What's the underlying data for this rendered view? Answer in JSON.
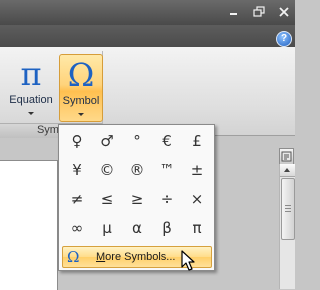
{
  "window": {
    "controls": [
      {
        "name": "minimize",
        "icon": "minimize-icon"
      },
      {
        "name": "restore",
        "icon": "restore-icon"
      },
      {
        "name": "close",
        "icon": "close-icon"
      }
    ],
    "help_glyph": "?"
  },
  "ribbon": {
    "group_label": "Symb",
    "equation": {
      "label": "Equation",
      "glyph": "π",
      "icon": "pi-icon"
    },
    "symbol": {
      "label": "Symbol",
      "glyph": "Ω",
      "icon": "omega-icon"
    }
  },
  "dropdown": {
    "symbols": [
      [
        "♀",
        "♂",
        "°",
        "€",
        "£"
      ],
      [
        "¥",
        "©",
        "®",
        "™",
        "±"
      ],
      [
        "≠",
        "≤",
        "≥",
        "÷",
        "×"
      ],
      [
        "∞",
        "μ",
        "α",
        "β",
        "π"
      ]
    ],
    "more_glyph": "Ω",
    "more_label_first": "M",
    "more_label_rest": "ore Symbols..."
  },
  "colors": {
    "accent_blue": "#1e62c2",
    "highlight_orange": "#ffd37b"
  }
}
